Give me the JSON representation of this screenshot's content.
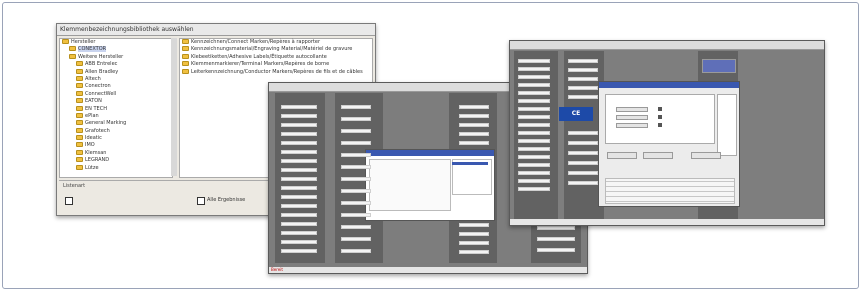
{
  "screenshot1": {
    "title": "Klemmenbezeichnungsbibliothek auswählen",
    "tree": [
      {
        "label": "Hersteller",
        "indent": 0,
        "selected": false
      },
      {
        "label": "CONEXTOR",
        "indent": 1,
        "selected": true
      },
      {
        "label": "Weitere Hersteller",
        "indent": 1,
        "selected": false
      },
      {
        "label": "ABB Entrelec",
        "indent": 2,
        "selected": false
      },
      {
        "label": "Allen Bradley",
        "indent": 2,
        "selected": false
      },
      {
        "label": "Altech",
        "indent": 2,
        "selected": false
      },
      {
        "label": "Conectron",
        "indent": 2,
        "selected": false
      },
      {
        "label": "ConnectWell",
        "indent": 2,
        "selected": false
      },
      {
        "label": "EATON",
        "indent": 2,
        "selected": false
      },
      {
        "label": "EN TECH",
        "indent": 2,
        "selected": false
      },
      {
        "label": "ePlan",
        "indent": 2,
        "selected": false
      },
      {
        "label": "General Marking",
        "indent": 2,
        "selected": false
      },
      {
        "label": "Grafotech",
        "indent": 2,
        "selected": false
      },
      {
        "label": "Ideatic",
        "indent": 2,
        "selected": false
      },
      {
        "label": "IMO",
        "indent": 2,
        "selected": false
      },
      {
        "label": "Klemsan",
        "indent": 2,
        "selected": false
      },
      {
        "label": "LEGRAND",
        "indent": 2,
        "selected": false
      },
      {
        "label": "Lütze",
        "indent": 2,
        "selected": false
      }
    ],
    "files": [
      "Kennzeichnen/Connect Marken/Repères à rapporter",
      "Kennzeichnungsmaterial/Engraving Material/Matériel de gravure",
      "Klebeetiketten/Adhesive Labels/Étiquette autocollante",
      "Klemmenmarkierer/Terminal Markers/Repères de borne",
      "Leiterkennzeichnung/Conductor Markers/Repères de fils et de câbles"
    ],
    "lower_caption": "Listenart",
    "option_left": "",
    "option_right": "Alle Ergebnisse"
  },
  "screenshot2": {
    "status_text": "Bereit"
  },
  "screenshot3": {
    "badge_text": "CE"
  }
}
